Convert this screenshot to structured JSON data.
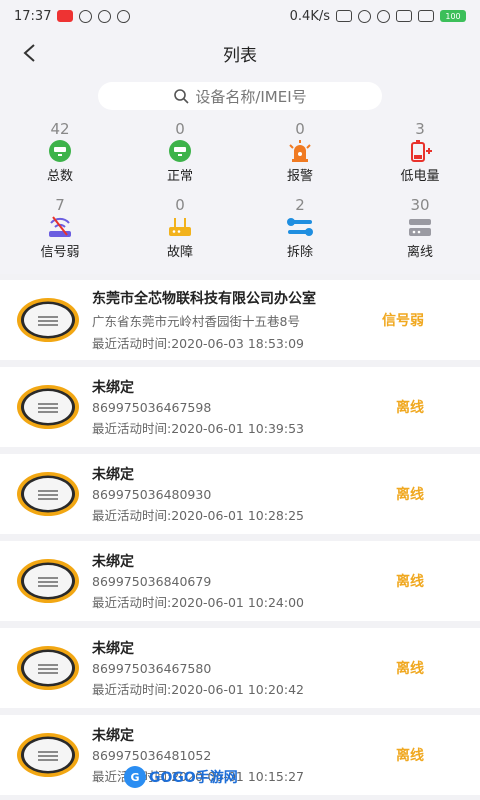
{
  "status_bar": {
    "time": "17:37",
    "network": "0.4K/s",
    "battery": "100"
  },
  "nav": {
    "title": "列表"
  },
  "search": {
    "placeholder": "设备名称/IMEI号"
  },
  "stats": [
    {
      "count": "42",
      "label": "总数",
      "icon": "device-green-icon"
    },
    {
      "count": "0",
      "label": "正常",
      "icon": "device-green-icon"
    },
    {
      "count": "0",
      "label": "报警",
      "icon": "alarm-bell-icon"
    },
    {
      "count": "3",
      "label": "低电量",
      "icon": "low-battery-icon"
    },
    {
      "count": "7",
      "label": "信号弱",
      "icon": "weak-signal-icon"
    },
    {
      "count": "0",
      "label": "故障",
      "icon": "fault-router-icon"
    },
    {
      "count": "2",
      "label": "拆除",
      "icon": "tools-icon"
    },
    {
      "count": "30",
      "label": "离线",
      "icon": "offline-device-icon"
    }
  ],
  "devices": [
    {
      "name": "东莞市全芯物联科技有限公司办公室",
      "line2": "广东省东莞市元岭村香园街十五巷8号",
      "line3": "最近活动时间:2020-06-03 18:53:09",
      "status": "信号弱"
    },
    {
      "name": "未绑定",
      "line2": "869975036467598",
      "line3": "最近活动时间:2020-06-01 10:39:53",
      "status": "离线"
    },
    {
      "name": "未绑定",
      "line2": "869975036480930",
      "line3": "最近活动时间:2020-06-01 10:28:25",
      "status": "离线"
    },
    {
      "name": "未绑定",
      "line2": "869975036840679",
      "line3": "最近活动时间:2020-06-01 10:24:00",
      "status": "离线"
    },
    {
      "name": "未绑定",
      "line2": "869975036467580",
      "line3": "最近活动时间:2020-06-01 10:20:42",
      "status": "离线"
    },
    {
      "name": "未绑定",
      "line2": "869975036481052",
      "line3": "最近活动时间:2020-06-01 10:15:27",
      "status": "离线"
    }
  ],
  "watermark": {
    "text": "GOGO手游网"
  },
  "colors": {
    "status": "#f0a820",
    "green": "#3db34a",
    "orange": "#f07a22",
    "blue": "#2a8df2"
  }
}
